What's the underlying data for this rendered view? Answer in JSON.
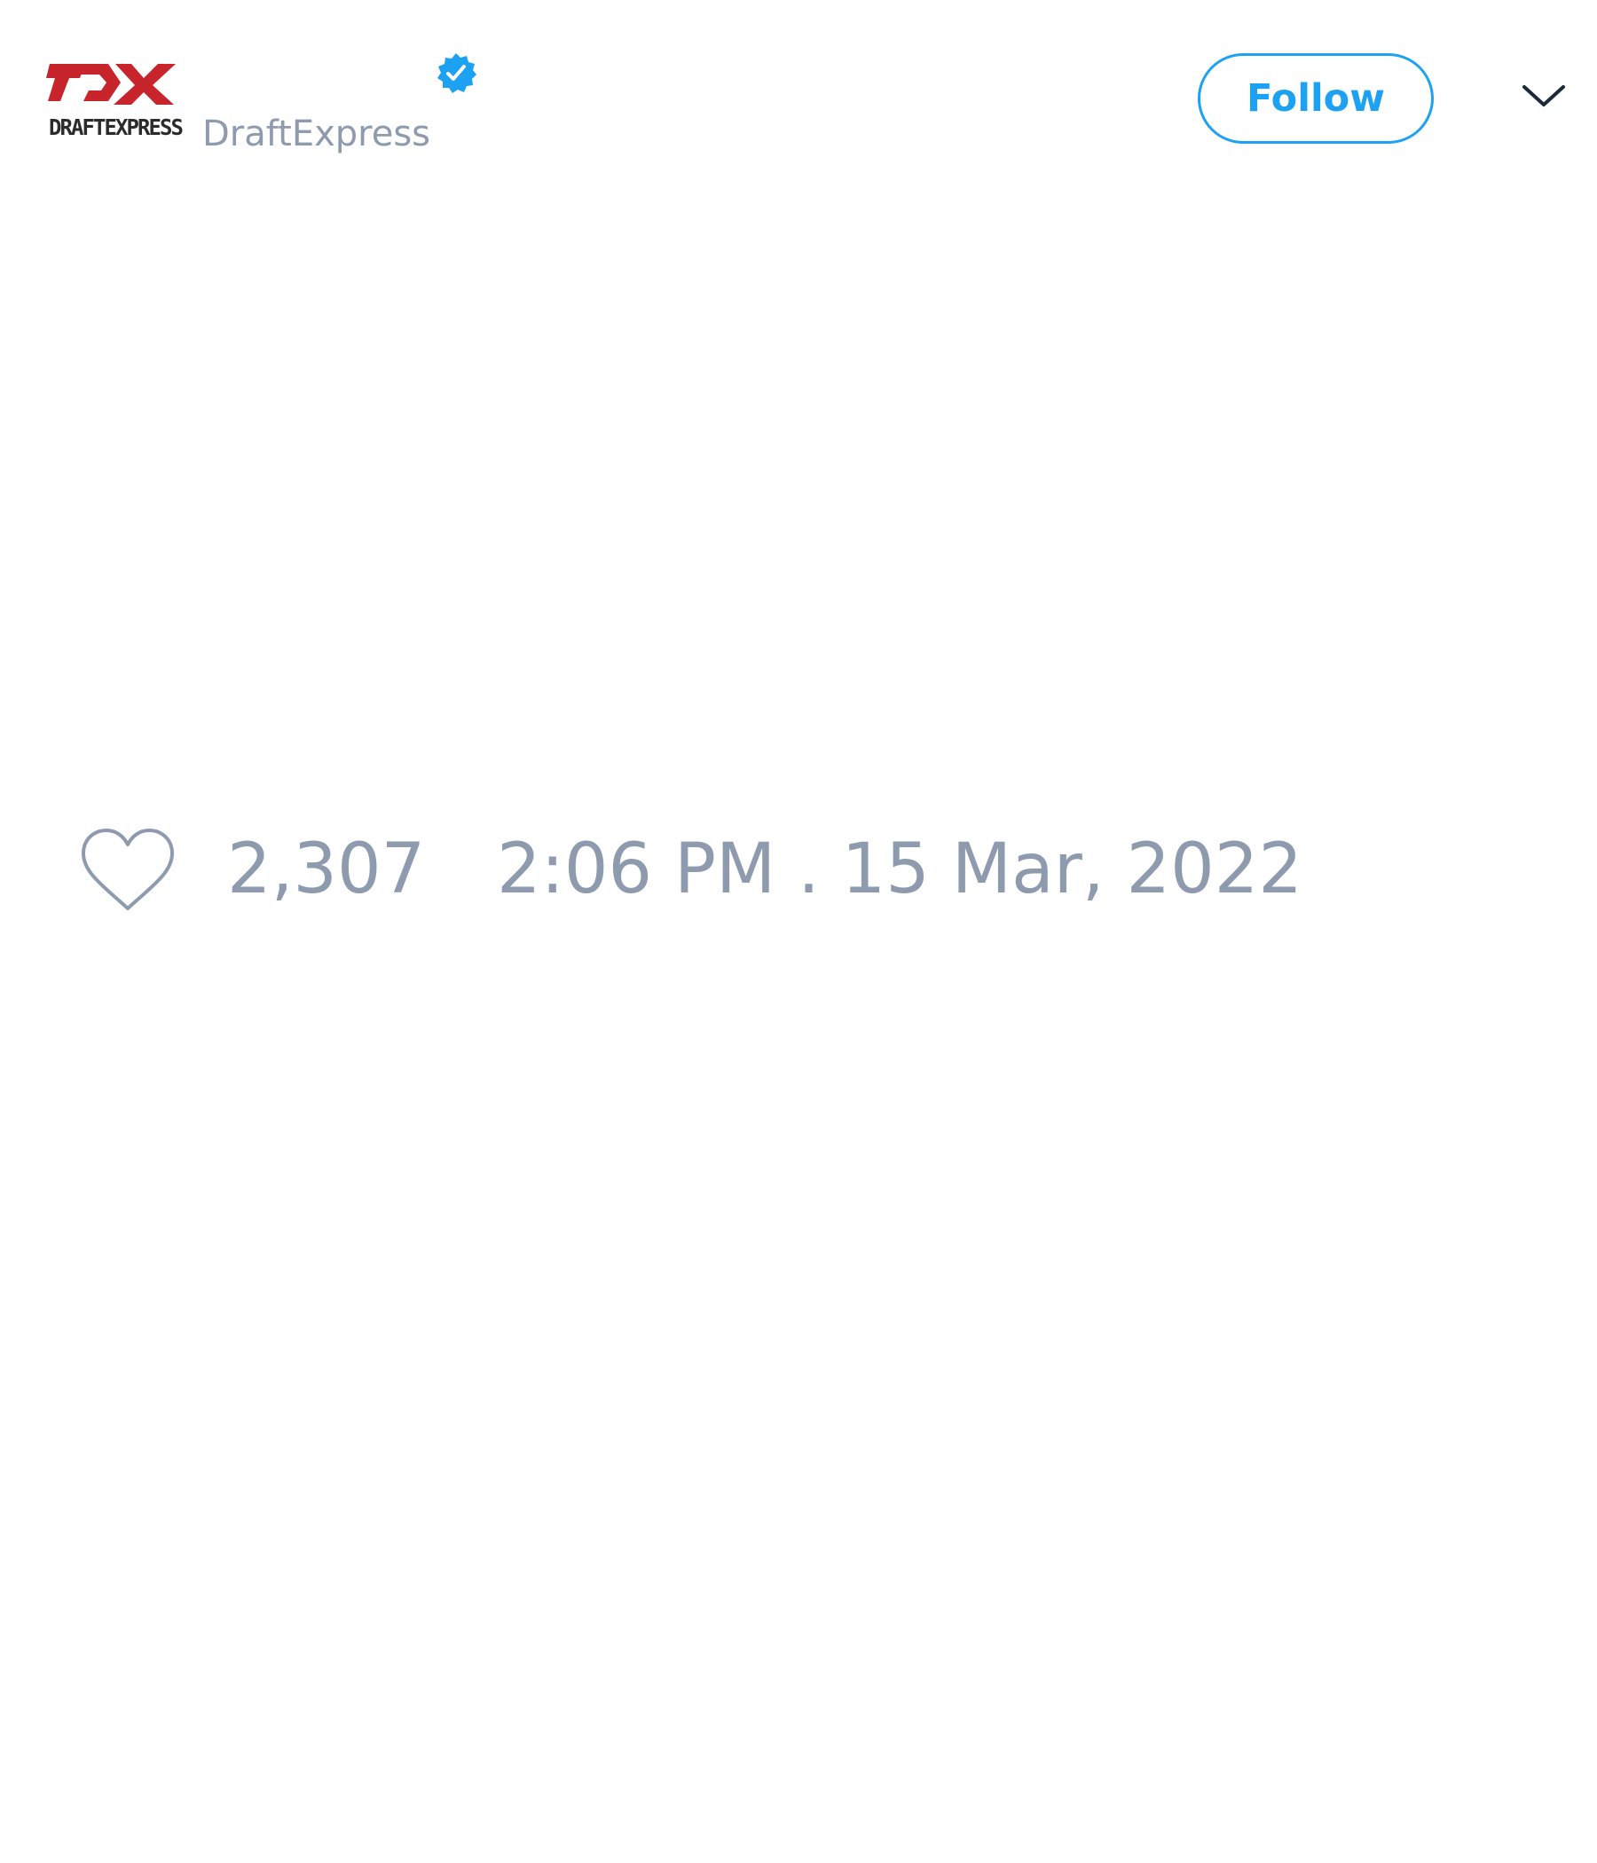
{
  "user": {
    "display_name": "",
    "handle": "DraftExpress",
    "verified": true,
    "avatar_icon": "draftexpress-logo",
    "avatar_text": "DRAFTEXPRESS"
  },
  "header": {
    "follow_label": "Follow",
    "menu_icon": "chevron-down-icon"
  },
  "actions": {
    "like_icon": "heart-icon",
    "like_count": "2,307",
    "timestamp": "2:06 PM . 15 Mar, 2022"
  },
  "colors": {
    "accent": "#1da1f2",
    "muted_text": "#8e9aad",
    "logo_red": "#c8242b",
    "logo_dark": "#2b2b2b"
  }
}
